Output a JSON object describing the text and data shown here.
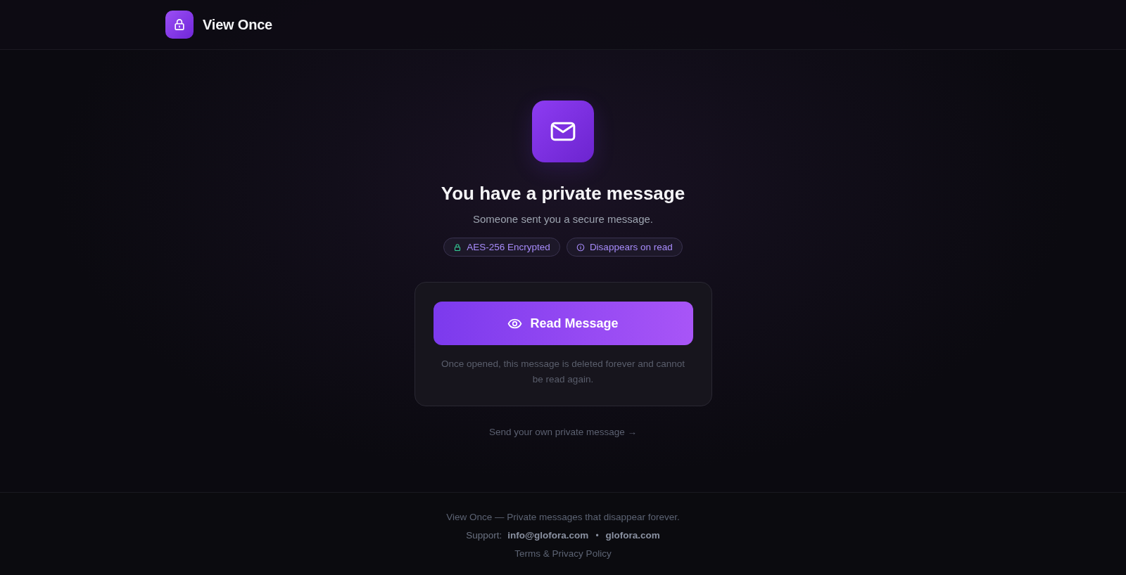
{
  "header": {
    "brand": "View Once"
  },
  "hero": {
    "title": "You have a private message",
    "subtitle": "Someone sent you a secure message.",
    "badges": [
      {
        "kind": "lock",
        "label": "AES-256 Encrypted"
      },
      {
        "kind": "info",
        "label": "Disappears on read"
      }
    ]
  },
  "card": {
    "button": "Read Message",
    "note": "Once opened, this message is deleted forever and cannot be read again."
  },
  "send_link": "Send your own private message →",
  "footer": {
    "tagline": "View Once — Private messages that disappear forever.",
    "support_label": "Support:",
    "links": [
      "info@glofora.com",
      "glofora.com"
    ],
    "separator": "•",
    "policy": "Terms & Privacy Policy"
  }
}
